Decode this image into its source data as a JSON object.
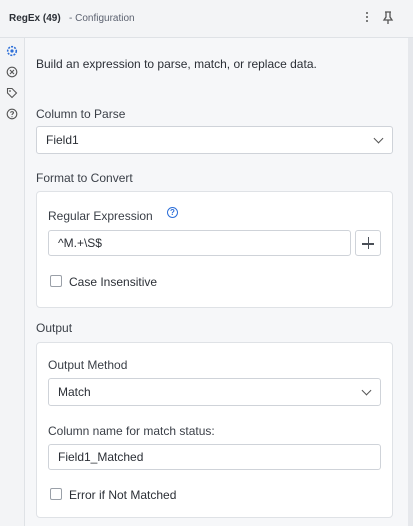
{
  "header": {
    "tool_name": "RegEx (49)",
    "subtitle": "- Configuration"
  },
  "rail": {
    "icons": [
      "gear-icon",
      "close-circle-icon",
      "tag-icon",
      "help-circle-icon"
    ],
    "active_color": "#2d6fd8"
  },
  "main": {
    "description": "Build an expression to parse, match, or replace data.",
    "column_to_parse": {
      "label": "Column to Parse",
      "value": "Field1"
    },
    "format_to_convert": {
      "section_title": "Format to Convert",
      "regex_label": "Regular Expression",
      "regex_value": "^M.+\\S$",
      "info_symbol": "?",
      "case_insensitive_label": "Case Insensitive",
      "case_insensitive_checked": false
    },
    "output": {
      "section_title": "Output",
      "method_label": "Output Method",
      "method_value": "Match",
      "column_name_label": "Column name for match status:",
      "column_name_value": "Field1_Matched",
      "error_label": "Error if Not Matched",
      "error_checked": false
    }
  }
}
